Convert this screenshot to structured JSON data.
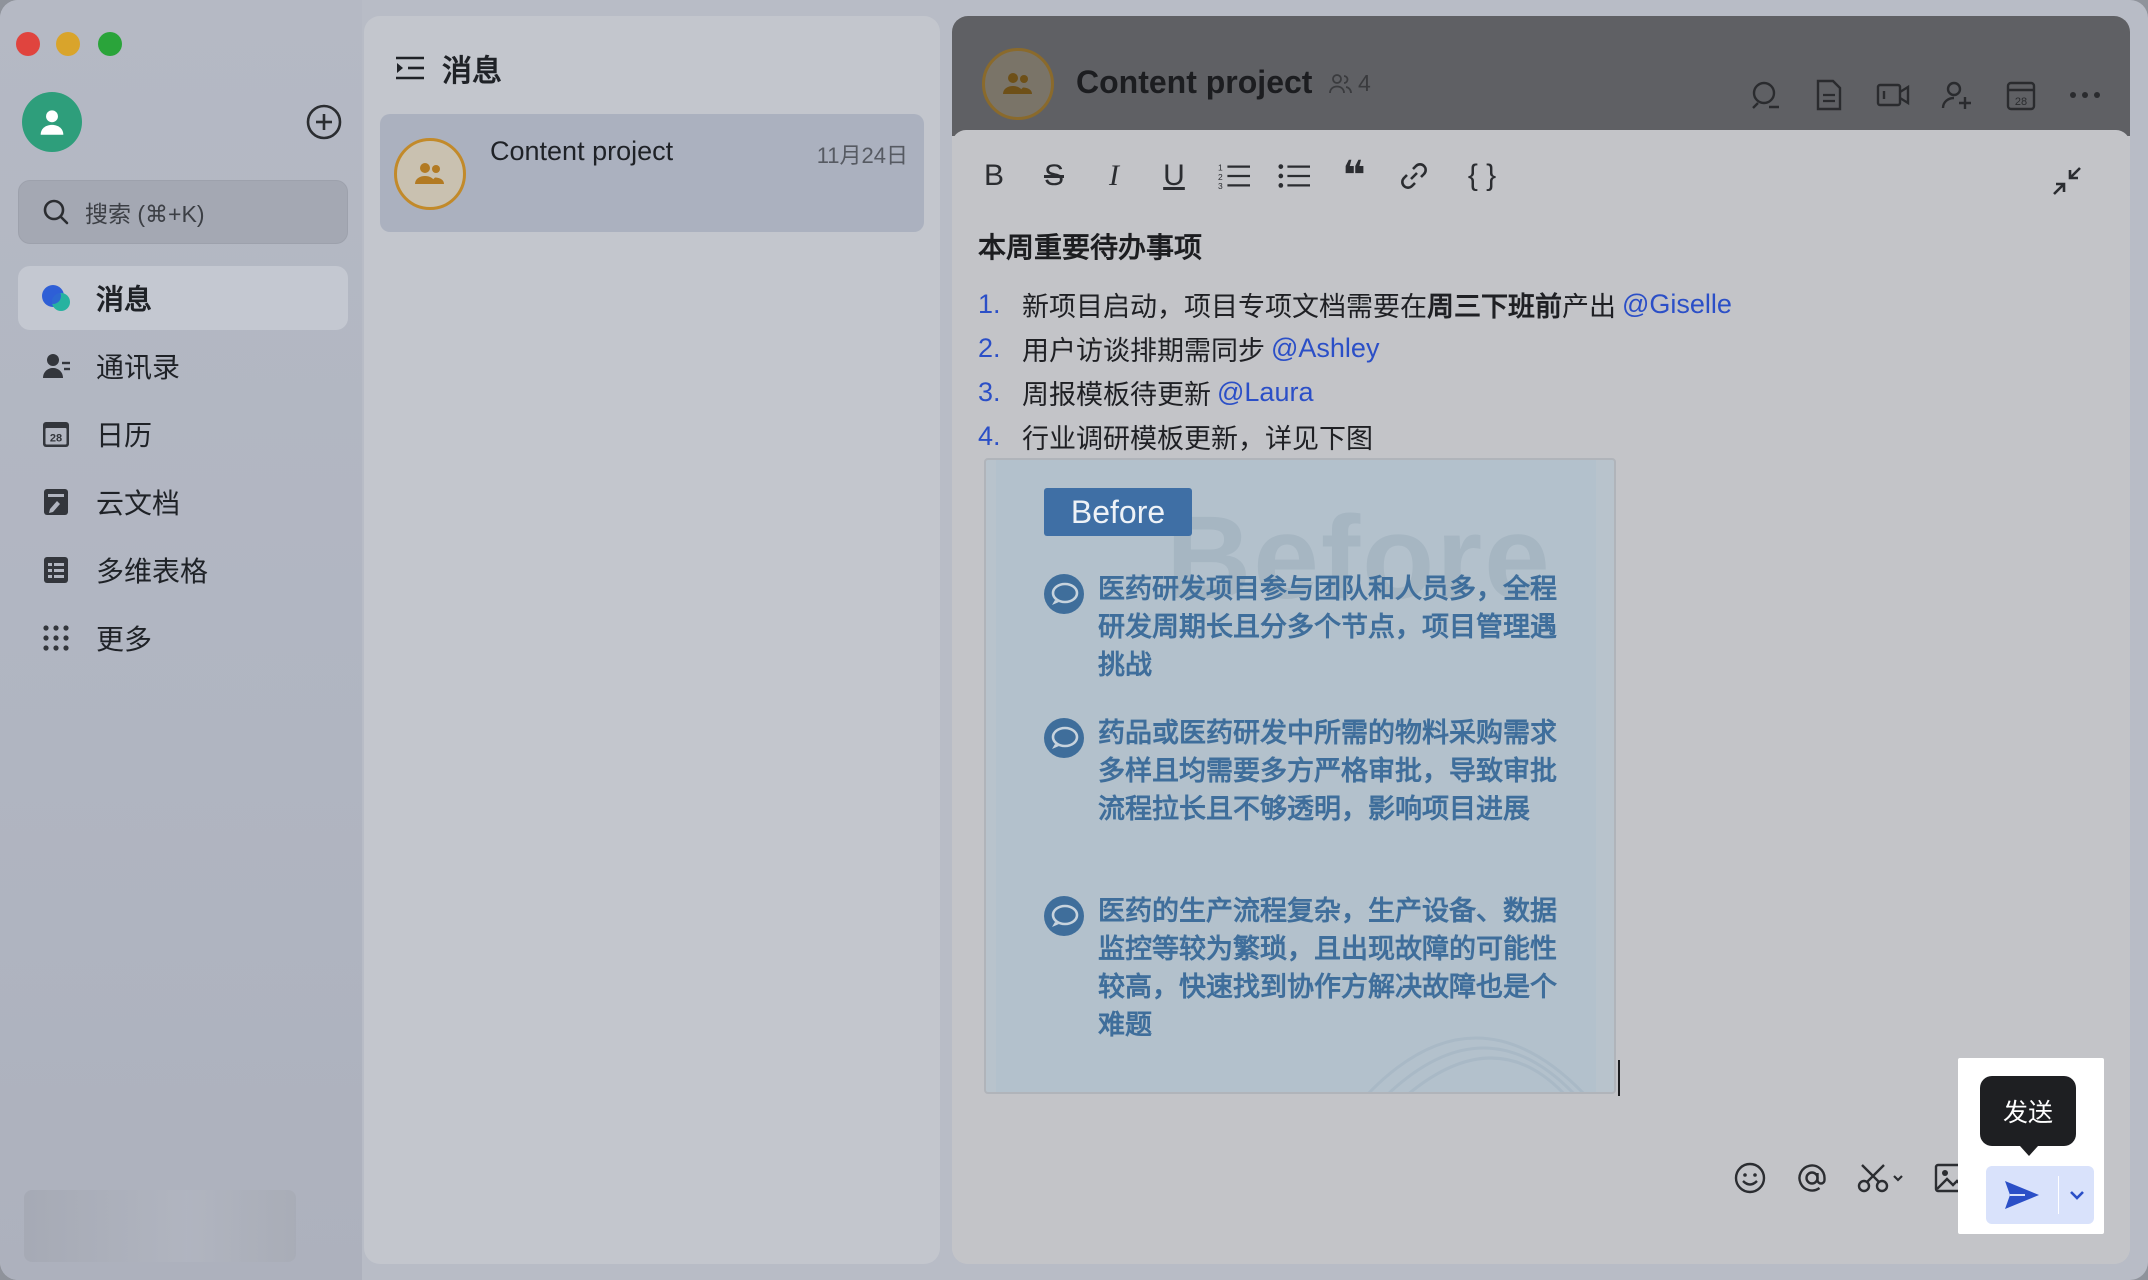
{
  "sidebar": {
    "search_placeholder": "搜索 (⌘+K)",
    "items": [
      {
        "label": "消息",
        "icon": "chat-bubbles-icon",
        "active": true
      },
      {
        "label": "通讯录",
        "icon": "contacts-icon"
      },
      {
        "label": "日历",
        "icon": "calendar-icon"
      },
      {
        "label": "云文档",
        "icon": "cloud-doc-icon"
      },
      {
        "label": "多维表格",
        "icon": "base-table-icon"
      },
      {
        "label": "更多",
        "icon": "more-grid-icon"
      }
    ],
    "calendar_day": "28"
  },
  "list": {
    "title": "消息",
    "chats": [
      {
        "name": "Content project",
        "date": "11月24日"
      }
    ]
  },
  "conversation": {
    "title": "Content project",
    "member_count": "4",
    "header_icons": [
      "search-icon",
      "document-icon",
      "video-call-icon",
      "add-member-icon",
      "calendar-icon",
      "more-icon"
    ],
    "header_calendar_day": "28",
    "toolbar": {
      "bold": "B",
      "strike": "S",
      "italic": "I",
      "underline": "U",
      "quote": "❝",
      "code": "{ }"
    },
    "doc_title": "本周重要待办事项",
    "todos": [
      {
        "num": "1.",
        "pre": "新项目启动，项目专项文档需要在",
        "bold": "周三下班前",
        "post": "产出",
        "mention": "@Giselle"
      },
      {
        "num": "2.",
        "pre": "用户访谈排期需同步",
        "bold": "",
        "post": "",
        "mention": "@Ashley"
      },
      {
        "num": "3.",
        "pre": "周报模板待更新",
        "bold": "",
        "post": "",
        "mention": "@Laura"
      },
      {
        "num": "4.",
        "pre": "行业调研模板更新，详见下图",
        "bold": "",
        "post": "",
        "mention": ""
      }
    ],
    "image": {
      "badge": "Before",
      "watermark": "Before",
      "bullets": [
        "医药研发项目参与团队和人员多，全程研发周期长且分多个节点，项目管理遇挑战",
        "药品或医药研发中所需的物料采购需求多样且均需要多方严格审批，导致审批流程拉长且不够透明，影响项目进展",
        "医药的生产流程复杂，生产设备、数据监控等较为繁琐，且出现故障的可能性较高，快速找到协作方解决故障也是个难题"
      ]
    },
    "send_tooltip": "发送",
    "accent_color": "#2b4fc7"
  }
}
